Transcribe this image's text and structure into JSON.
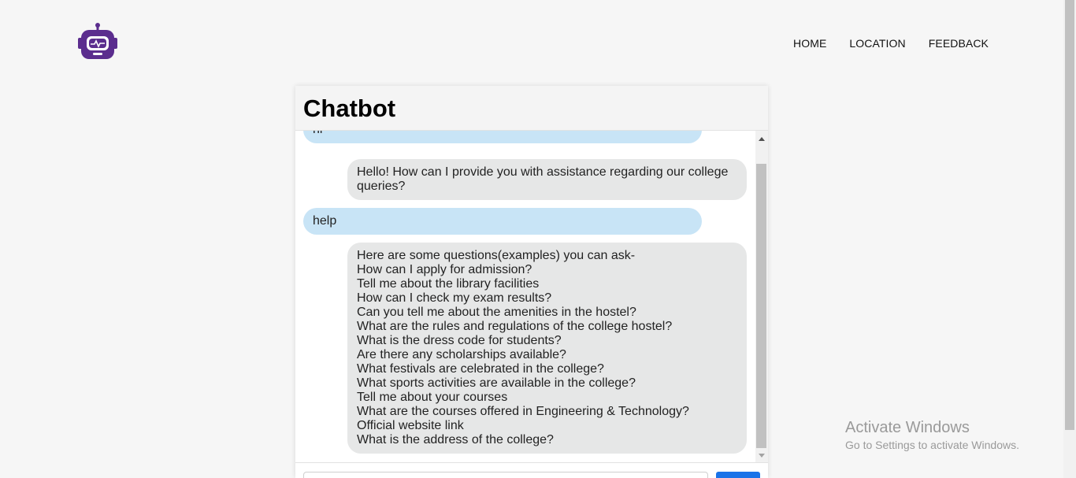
{
  "header": {
    "logo_icon": "robot-icon",
    "nav": [
      {
        "label": "HOME"
      },
      {
        "label": "LOCATION"
      },
      {
        "label": "FEEDBACK"
      }
    ]
  },
  "chat": {
    "title": "Chatbot",
    "messages": [
      {
        "from": "user",
        "text": "hi"
      },
      {
        "from": "bot",
        "lines": [
          "Hello! How can I provide you with assistance regarding our college",
          "queries?"
        ]
      },
      {
        "from": "user",
        "text": "help"
      },
      {
        "from": "bot",
        "lines": [
          "Here are some questions(examples) you can ask-",
          "How can I apply for admission?",
          "Tell me about the library facilities",
          "How can I check my exam results?",
          "Can you tell me about the amenities in the hostel?",
          "What are the rules and regulations of the college hostel?",
          "What is the dress code for students?",
          "Are there any scholarships available?",
          "What festivals are celebrated in the college?",
          "What sports activities are available in the college?",
          "Tell me about your courses",
          "What are the courses offered in Engineering & Technology?",
          "Official website link",
          "What is the address of the college?"
        ]
      }
    ]
  },
  "watermark": {
    "title": "Activate Windows",
    "subtitle": "Go to Settings to activate Windows."
  },
  "colors": {
    "accent": "#5b2d8e",
    "user_bubble": "#c8e4f6",
    "bot_bubble": "#e6e7e7",
    "send_button": "#1a73e8"
  }
}
